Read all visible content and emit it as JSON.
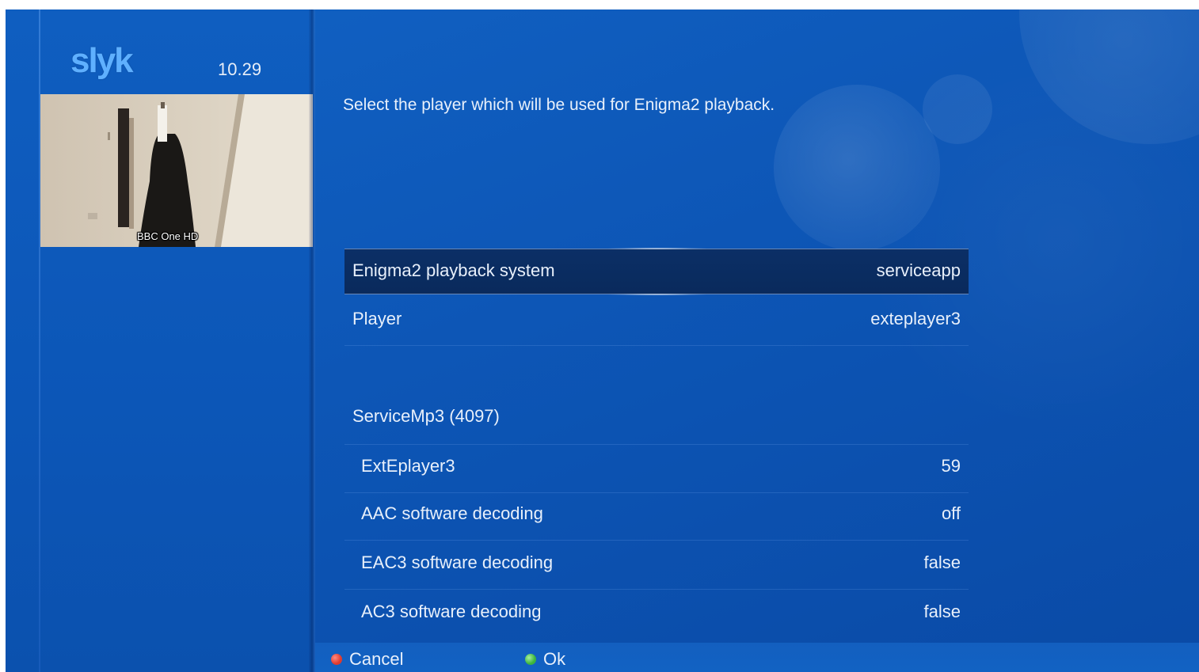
{
  "header": {
    "logo_text": "slyk",
    "clock": "10.29"
  },
  "preview": {
    "channel_label": "BBC One HD"
  },
  "main": {
    "description": "Select the player which will be used for Enigma2 playback.",
    "settings": [
      {
        "label": "Enigma2 playback system",
        "value": "serviceapp",
        "selected": true
      },
      {
        "label": "Player",
        "value": "exteplayer3"
      },
      {
        "label": "ServiceMp3 (4097)",
        "value": ""
      },
      {
        "label": "ExtEplayer3",
        "value": "59"
      },
      {
        "label": "AAC software decoding",
        "value": "off"
      },
      {
        "label": "EAC3 software decoding",
        "value": "false"
      },
      {
        "label": "AC3 software decoding",
        "value": "false"
      }
    ]
  },
  "footer": {
    "cancel_label": "Cancel",
    "cancel_color": "#e03a2e",
    "ok_label": "Ok",
    "ok_color": "#3cb43c"
  }
}
